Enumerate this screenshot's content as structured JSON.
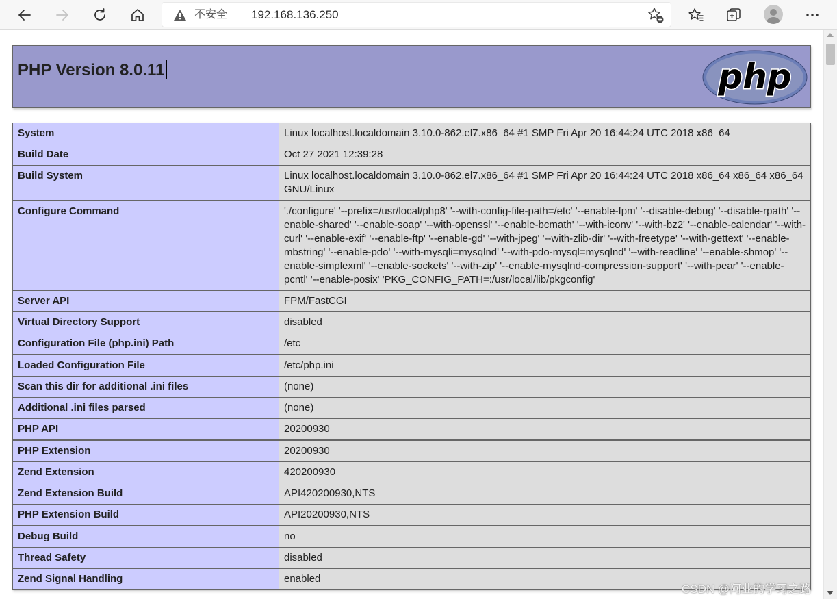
{
  "browser": {
    "security_label": "不安全",
    "url": "192.168.136.250",
    "icons": [
      "back-icon",
      "forward-icon",
      "reload-icon",
      "home-icon",
      "warning-icon",
      "add-favorite-icon",
      "favorites-icon",
      "collections-icon",
      "profile-avatar",
      "more-icon"
    ]
  },
  "page": {
    "title": "PHP Version 8.0.11",
    "logo_text": "php",
    "rows": [
      {
        "label": "System",
        "value": "Linux localhost.localdomain 3.10.0-862.el7.x86_64 #1 SMP Fri Apr 20 16:44:24 UTC 2018 x86_64"
      },
      {
        "label": "Build Date",
        "value": "Oct 27 2021 12:39:28"
      },
      {
        "label": "Build System",
        "value": "Linux localhost.localdomain 3.10.0-862.el7.x86_64 #1 SMP Fri Apr 20 16:44:24 UTC 2018 x86_64 x86_64 x86_64 GNU/Linux"
      },
      {
        "label": "Configure Command",
        "value": "'./configure' '--prefix=/usr/local/php8' '--with-config-file-path=/etc' '--enable-fpm' '--disable-debug' '--disable-rpath' '--enable-shared' '--enable-soap' '--with-openssl' '--enable-bcmath' '--with-iconv' '--with-bz2' '--enable-calendar' '--with-curl' '--enable-exif' '--enable-ftp' '--enable-gd' '--with-jpeg' '--with-zlib-dir' '--with-freetype' '--with-gettext' '--enable-mbstring' '--enable-pdo' '--with-mysqli=mysqlnd' '--with-pdo-mysql=mysqlnd' '--with-readline' '--enable-shmop' '--enable-simplexml' '--enable-sockets' '--with-zip' '--enable-mysqlnd-compression-support' '--with-pear' '--enable-pcntl' '--enable-posix' 'PKG_CONFIG_PATH=:/usr/local/lib/pkgconfig'"
      },
      {
        "label": "Server API",
        "value": "FPM/FastCGI"
      },
      {
        "label": "Virtual Directory Support",
        "value": "disabled"
      },
      {
        "label": "Configuration File (php.ini) Path",
        "value": "/etc"
      },
      {
        "label": "Loaded Configuration File",
        "value": "/etc/php.ini"
      },
      {
        "label": "Scan this dir for additional .ini files",
        "value": "(none)"
      },
      {
        "label": "Additional .ini files parsed",
        "value": "(none)"
      },
      {
        "label": "PHP API",
        "value": "20200930"
      },
      {
        "label": "PHP Extension",
        "value": "20200930"
      },
      {
        "label": "Zend Extension",
        "value": "420200930"
      },
      {
        "label": "Zend Extension Build",
        "value": "API420200930,NTS"
      },
      {
        "label": "PHP Extension Build",
        "value": "API20200930,NTS"
      },
      {
        "label": "Debug Build",
        "value": "no"
      },
      {
        "label": "Thread Safety",
        "value": "disabled"
      },
      {
        "label": "Zend Signal Handling",
        "value": "enabled"
      }
    ]
  },
  "watermark": "CSDN @阿业的学习之路",
  "colors": {
    "header_bg": "#9999cc",
    "label_bg": "#ccccff",
    "value_bg": "#dddddd",
    "border": "#666666"
  }
}
